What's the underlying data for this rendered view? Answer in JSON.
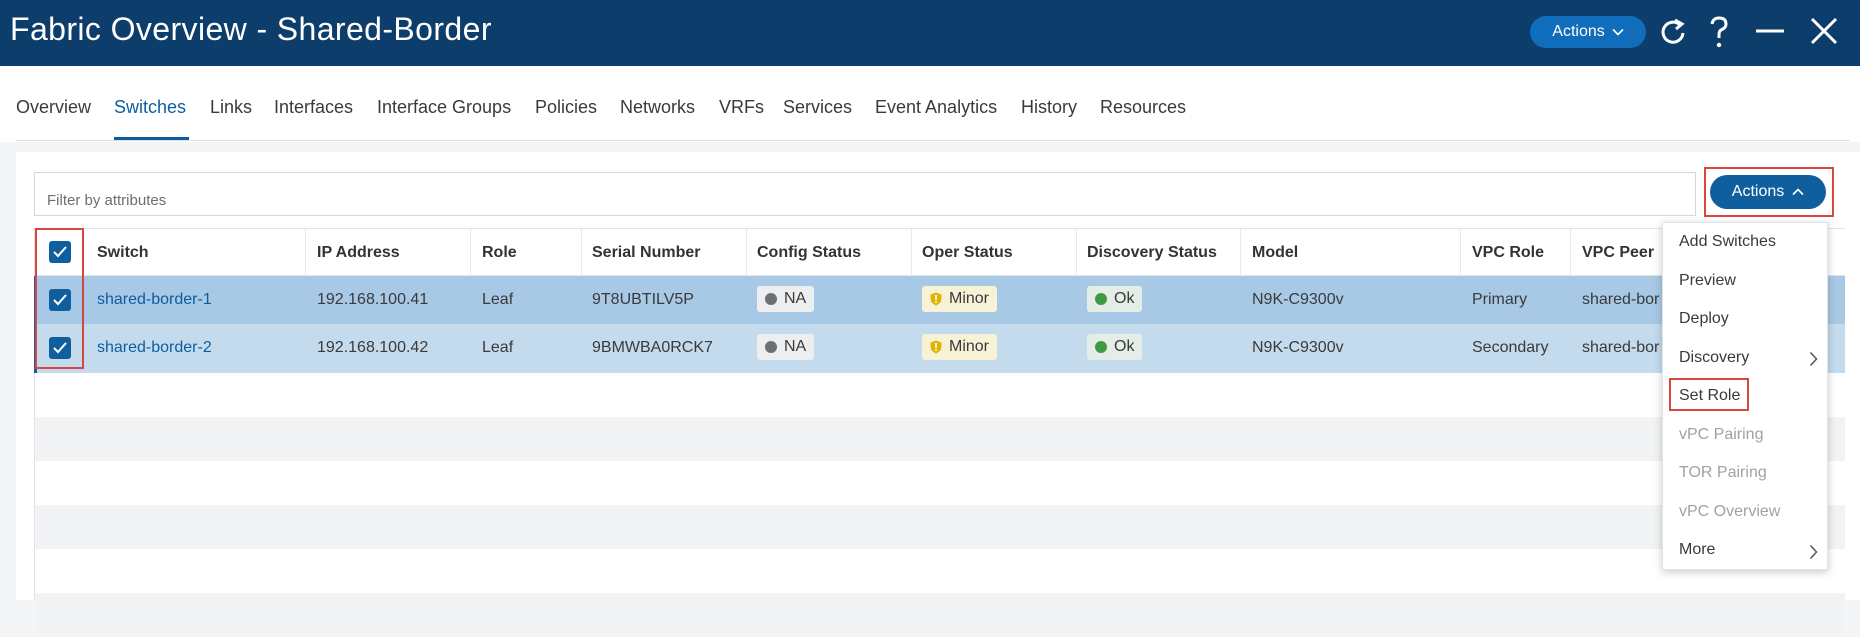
{
  "header": {
    "title": "Fabric Overview - Shared-Border",
    "actions_label": "Actions",
    "bg_color": "#0d3e6b"
  },
  "tabs": [
    {
      "label": "Overview"
    },
    {
      "label": "Switches",
      "active": true
    },
    {
      "label": "Links"
    },
    {
      "label": "Interfaces"
    },
    {
      "label": "Interface Groups"
    },
    {
      "label": "Policies"
    },
    {
      "label": "Networks"
    },
    {
      "label": "VRFs"
    },
    {
      "label": "Services"
    },
    {
      "label": "Event Analytics"
    },
    {
      "label": "History"
    },
    {
      "label": "Resources"
    }
  ],
  "filter": {
    "placeholder": "Filter by attributes"
  },
  "panel_actions": {
    "label": "Actions"
  },
  "table": {
    "columns": [
      "Switch",
      "IP Address",
      "Role",
      "Serial Number",
      "Config Status",
      "Oper Status",
      "Discovery Status",
      "Model",
      "VPC Role",
      "VPC Peer"
    ],
    "rows": [
      {
        "switch": "shared-border-1",
        "ip": "192.168.100.41",
        "role": "Leaf",
        "serial": "9T8UBTILV5P",
        "config_status": "NA",
        "oper_status": "Minor",
        "discovery_status": "Ok",
        "model": "N9K-C9300v",
        "vpc_role": "Primary",
        "vpc_peer": "shared-bor",
        "selected": true
      },
      {
        "switch": "shared-border-2",
        "ip": "192.168.100.42",
        "role": "Leaf",
        "serial": "9BMWBA0RCK7",
        "config_status": "NA",
        "oper_status": "Minor",
        "discovery_status": "Ok",
        "model": "N9K-C9300v",
        "vpc_role": "Secondary",
        "vpc_peer": "shared-bor",
        "selected": true
      }
    ]
  },
  "actions_menu": {
    "items": [
      {
        "label": "Add Switches",
        "enabled": true
      },
      {
        "label": "Preview",
        "enabled": true
      },
      {
        "label": "Deploy",
        "enabled": true
      },
      {
        "label": "Discovery",
        "enabled": true,
        "submenu": true
      },
      {
        "label": "Set Role",
        "enabled": true,
        "highlighted": true
      },
      {
        "label": "vPC Pairing",
        "enabled": false
      },
      {
        "label": "TOR Pairing",
        "enabled": false
      },
      {
        "label": "vPC Overview",
        "enabled": false
      },
      {
        "label": "More",
        "enabled": true,
        "submenu": true
      }
    ]
  },
  "colors": {
    "accent": "#0f5f9f",
    "highlight_box": "#d9453f",
    "selected_row": "#a7c9e6",
    "status_ok": "#3f9b43",
    "status_minor": "#e0b400"
  }
}
